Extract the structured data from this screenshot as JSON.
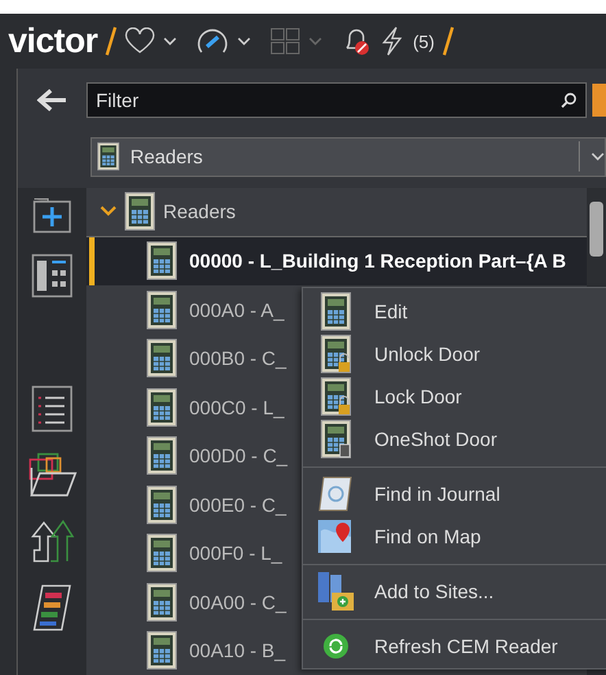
{
  "topbar": {
    "logo": "victor",
    "alarm_count": "(5)"
  },
  "filter": {
    "placeholder": "Filter"
  },
  "view_select": {
    "value": "Readers"
  },
  "tree": {
    "label": "Readers",
    "expanded": true,
    "children": [
      {
        "label": "00000 - L_Building 1 Reception Part–{A B",
        "selected": true
      },
      {
        "label": "000A0 - A_",
        "selected": false
      },
      {
        "label": "000B0 - C_",
        "selected": false
      },
      {
        "label": "000C0 - L_",
        "selected": false
      },
      {
        "label": "000D0 - C_",
        "selected": false
      },
      {
        "label": "000E0 - C_",
        "selected": false
      },
      {
        "label": "000F0 - L_",
        "selected": false
      },
      {
        "label": "00A00 - C_",
        "selected": false
      },
      {
        "label": "00A10 - B_",
        "selected": false
      }
    ]
  },
  "context_menu": {
    "items": [
      {
        "kind": "item",
        "label": "Edit"
      },
      {
        "kind": "item",
        "label": "Unlock Door"
      },
      {
        "kind": "item",
        "label": "Lock Door"
      },
      {
        "kind": "item",
        "label": "OneShot Door"
      },
      {
        "kind": "separator"
      },
      {
        "kind": "item",
        "label": "Find in Journal"
      },
      {
        "kind": "item",
        "label": "Find on Map"
      },
      {
        "kind": "separator"
      },
      {
        "kind": "item",
        "label": "Add to Sites..."
      },
      {
        "kind": "separator"
      },
      {
        "kind": "item",
        "label": "Refresh CEM Reader"
      }
    ]
  }
}
